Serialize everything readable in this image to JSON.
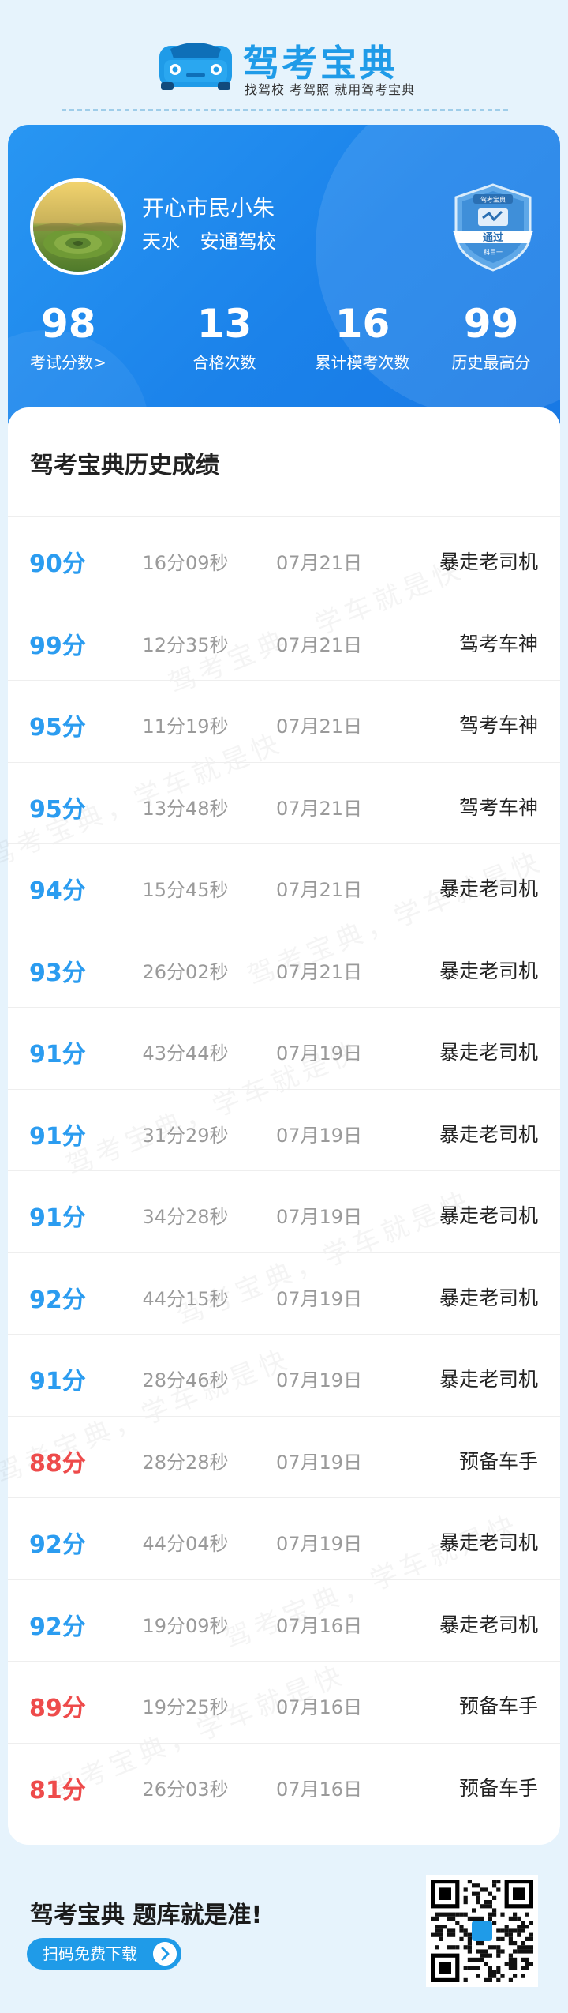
{
  "header": {
    "brand_name": "驾考宝典",
    "slogan": "找驾校 考驾照 就用驾考宝典",
    "logo_icon": "car-logo-icon"
  },
  "profile": {
    "name": "开心市民小朱",
    "city": "天水",
    "school": "安通驾校",
    "badge": {
      "brand": "驾考宝典",
      "label": "通过",
      "subject": "科目一",
      "icon": "pass-badge-icon"
    },
    "stats": [
      {
        "value": "98",
        "label": "考试分数>"
      },
      {
        "value": "13",
        "label": "合格次数"
      },
      {
        "value": "16",
        "label": "累计模考次数"
      },
      {
        "value": "99",
        "label": "历史最高分"
      }
    ]
  },
  "records": {
    "title": "驾考宝典历史成绩",
    "watermark": "驾考宝典，学车就是快",
    "rows": [
      {
        "score": "90分",
        "time": "16分09秒",
        "date": "07月21日",
        "rank": "暴走老司机",
        "pass": true
      },
      {
        "score": "99分",
        "time": "12分35秒",
        "date": "07月21日",
        "rank": "驾考车神",
        "pass": true
      },
      {
        "score": "95分",
        "time": "11分19秒",
        "date": "07月21日",
        "rank": "驾考车神",
        "pass": true
      },
      {
        "score": "95分",
        "time": "13分48秒",
        "date": "07月21日",
        "rank": "驾考车神",
        "pass": true
      },
      {
        "score": "94分",
        "time": "15分45秒",
        "date": "07月21日",
        "rank": "暴走老司机",
        "pass": true
      },
      {
        "score": "93分",
        "time": "26分02秒",
        "date": "07月21日",
        "rank": "暴走老司机",
        "pass": true
      },
      {
        "score": "91分",
        "time": "43分44秒",
        "date": "07月19日",
        "rank": "暴走老司机",
        "pass": true
      },
      {
        "score": "91分",
        "time": "31分29秒",
        "date": "07月19日",
        "rank": "暴走老司机",
        "pass": true
      },
      {
        "score": "91分",
        "time": "34分28秒",
        "date": "07月19日",
        "rank": "暴走老司机",
        "pass": true
      },
      {
        "score": "92分",
        "time": "44分15秒",
        "date": "07月19日",
        "rank": "暴走老司机",
        "pass": true
      },
      {
        "score": "91分",
        "time": "28分46秒",
        "date": "07月19日",
        "rank": "暴走老司机",
        "pass": true
      },
      {
        "score": "88分",
        "time": "28分28秒",
        "date": "07月19日",
        "rank": "预备车手",
        "pass": false
      },
      {
        "score": "92分",
        "time": "44分04秒",
        "date": "07月19日",
        "rank": "暴走老司机",
        "pass": true
      },
      {
        "score": "92分",
        "time": "19分09秒",
        "date": "07月16日",
        "rank": "暴走老司机",
        "pass": true
      },
      {
        "score": "89分",
        "time": "19分25秒",
        "date": "07月16日",
        "rank": "预备车手",
        "pass": false
      },
      {
        "score": "81分",
        "time": "26分03秒",
        "date": "07月16日",
        "rank": "预备车手",
        "pass": false
      }
    ]
  },
  "footer": {
    "tagline": "驾考宝典 题库就是准!",
    "download_label": "扫码免费下载",
    "qr_icon": "qr-code-icon",
    "arrow_icon": "chevron-right-icon"
  },
  "colors": {
    "accent": "#1f9be8",
    "pass_score": "#2b9cf0",
    "fail_score": "#ee4b4b",
    "card_blue": "#1b82ea",
    "page_bg": "#e6f3fc"
  }
}
